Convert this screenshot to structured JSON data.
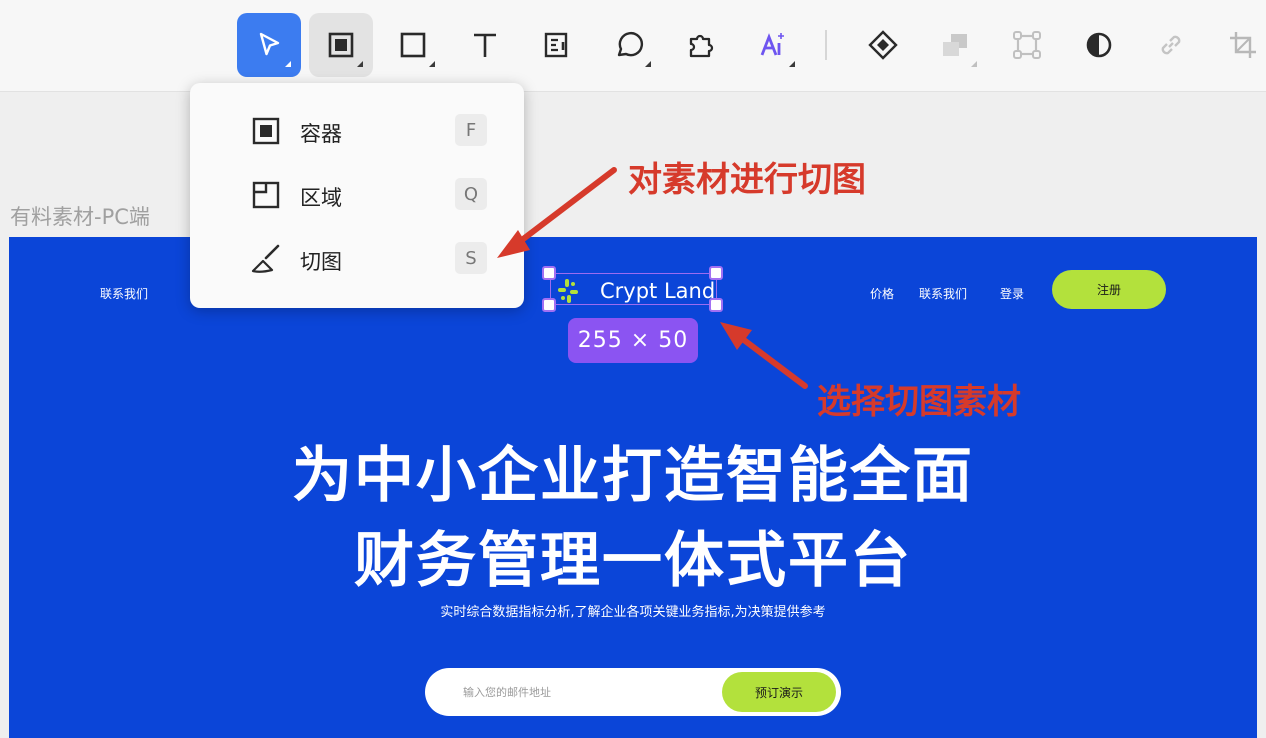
{
  "toolbar": {
    "tools": [
      "select-tool",
      "container-tool",
      "rectangle-tool",
      "text-tool",
      "text-block-tool",
      "comment-tool",
      "plugin-tool",
      "ai-tool",
      "component-tool",
      "boolean-tool",
      "transform-tool",
      "mask-tool",
      "link-tool",
      "crop-tool"
    ]
  },
  "menu": {
    "items": [
      {
        "label": "容器",
        "shortcut": "F",
        "icon": "container-icon"
      },
      {
        "label": "区域",
        "shortcut": "Q",
        "icon": "area-icon"
      },
      {
        "label": "切图",
        "shortcut": "S",
        "icon": "knife-icon"
      }
    ]
  },
  "canvas": {
    "frame_label": "有料素材-PC端",
    "nav": {
      "left_link": "联系我们",
      "right_links": [
        "价格",
        "联系我们",
        "登录"
      ],
      "signup": "注册"
    },
    "logo_text": "Crypt Land",
    "selection_size": "255 × 50",
    "hero_line1": "为中小企业打造智能全面",
    "hero_line2": "财务管理一体式平台",
    "hero_sub": "实时综合数据指标分析,了解企业各项关键业务指标,为决策提供参考",
    "email_placeholder": "输入您的邮件地址",
    "demo_button": "预订演示"
  },
  "annotations": {
    "top": "对素材进行切图",
    "bottom": "选择切图素材"
  },
  "colors": {
    "frame_bg": "#0b45d8",
    "accent_green": "#b3e13c",
    "selection_purple": "#8b54f2",
    "annotation_red": "#d63a2b",
    "active_tool": "#3c7cf0"
  }
}
